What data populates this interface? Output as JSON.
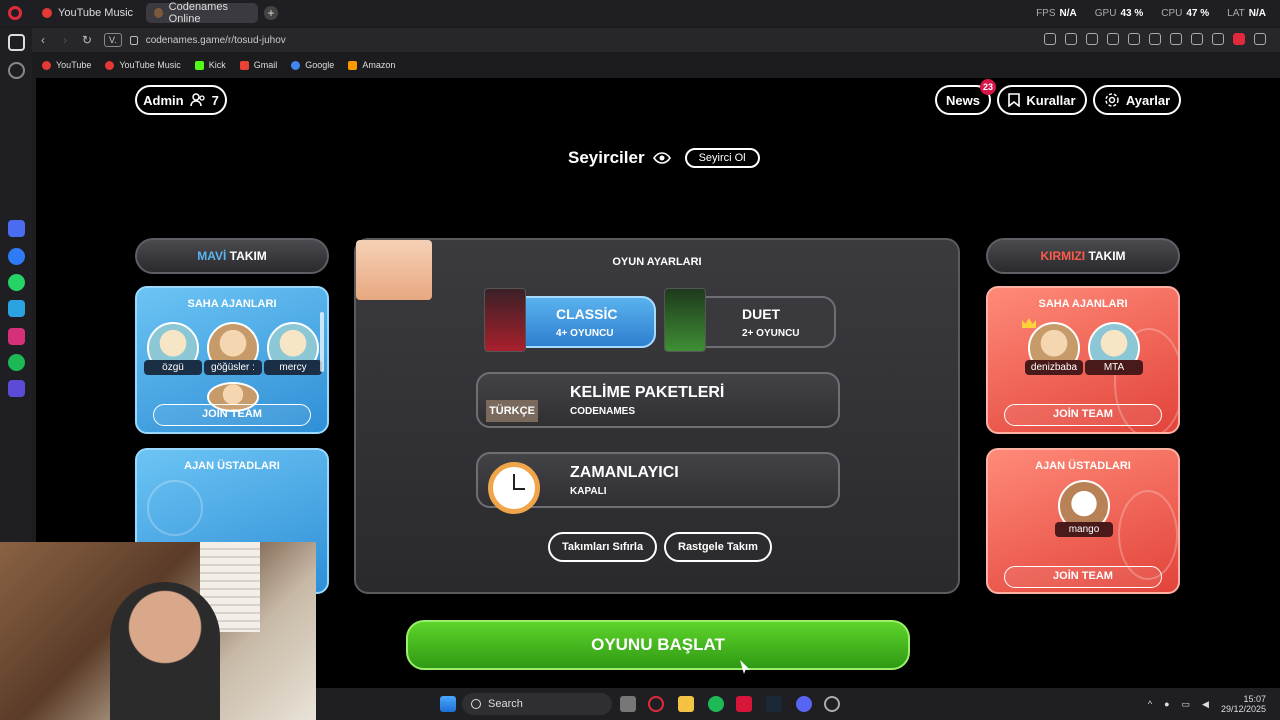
{
  "browser": {
    "tabs": [
      {
        "label": "YouTube Music",
        "active": false
      },
      {
        "label": "Codenames Online",
        "active": true
      }
    ],
    "perf": [
      {
        "label": "FPS",
        "value": "N/A"
      },
      {
        "label": "GPU",
        "value": "43 %"
      },
      {
        "label": "CPU",
        "value": "47 %"
      },
      {
        "label": "LAT",
        "value": "N/A"
      }
    ],
    "url_pill": "V.",
    "url": "codenames.game/r/tosud-juhov",
    "bookmarks": [
      "YouTube",
      "YouTube Music",
      "Kick",
      "Gmail",
      "Google",
      "Amazon"
    ]
  },
  "header": {
    "admin_label": "Admin",
    "player_count": "7",
    "news_label": "News",
    "news_badge": "23",
    "rules_label": "Kurallar",
    "settings_label": "Ayarlar"
  },
  "spectators": {
    "title": "Seyirciler",
    "become_label": "Seyirci Ol"
  },
  "blue_team": {
    "title_color_word": "MAVİ",
    "title_rest": "TAKIM",
    "operatives_title": "SAHA AJANLARI",
    "players": [
      "özgü",
      "göğüsler :",
      "mercy"
    ],
    "join_label": "JOİN TEAM",
    "spymasters_title": "AJAN ÜSTADLARI"
  },
  "red_team": {
    "title_color_word": "KIRMIZI",
    "title_rest": "TAKIM",
    "operatives_title": "SAHA AJANLARI",
    "players": [
      "denizbaba",
      "MTA"
    ],
    "join_label": "JOİN TEAM",
    "spymasters_title": "AJAN ÜSTADLARI",
    "spymaster_players": [
      "mango"
    ],
    "spymaster_join_label": "JOİN TEAM"
  },
  "game_settings": {
    "title": "OYUN AYARLARI",
    "modes": [
      {
        "label": "CLASSİC",
        "sub": "4+ OYUNCU",
        "selected": true
      },
      {
        "label": "DUET",
        "sub": "2+ OYUNCU",
        "selected": false
      }
    ],
    "word_packs": {
      "label": "KELİME PAKETLERİ",
      "sub": "CODENAMES",
      "box_text": "TÜRKÇE"
    },
    "timer": {
      "label": "ZAMANLAYICI",
      "sub": "KAPALI"
    },
    "reset_teams_label": "Takımları Sıfırla",
    "random_teams_label": "Rastgele Takım"
  },
  "start_button_label": "OYUNU BAŞLAT",
  "taskbar": {
    "search_label": "Search",
    "time": "15:07",
    "date": "29/12/2025"
  },
  "colors": {
    "blue_accent": "#5ab4f0",
    "red_accent": "#ff5a4a",
    "start_green": "#3fb81c",
    "news_badge": "#d8164a"
  }
}
